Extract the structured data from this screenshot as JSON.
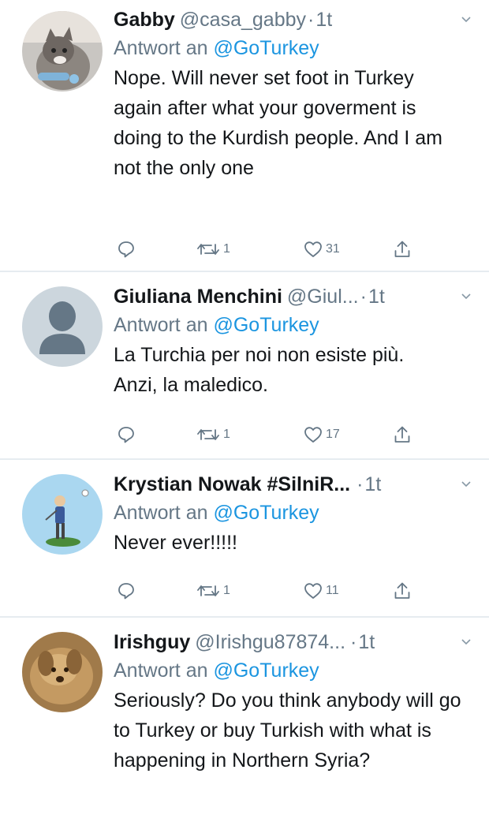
{
  "colors": {
    "accent": "#1b95e0",
    "muted": "#657786",
    "text": "#14171a",
    "divider": "#e6ecf0"
  },
  "tweets": [
    {
      "name": "Gabby",
      "handle": "@casa_gabby",
      "sep": "·",
      "time": "1t",
      "reply_prefix": "Antwort an",
      "reply_to": "@GoTurkey",
      "text": "Nope. Will never set foot in Turkey again after what your goverment is doing to the Kurdish people. And I am not the only one",
      "replies": "",
      "retweets": "1",
      "likes": "31",
      "avatar_icon": "cat-photo-avatar"
    },
    {
      "name": "Giuliana Menchini",
      "handle": "@Giul...",
      "sep": "·",
      "time": "1t",
      "reply_prefix": "Antwort an",
      "reply_to": "@GoTurkey",
      "text": "La Turchia per noi non esiste più. Anzi, la maledico.",
      "replies": "",
      "retweets": "1",
      "likes": "17",
      "avatar_icon": "default-person-avatar"
    },
    {
      "name": "Krystian Nowak #SilniR...",
      "handle": "",
      "sep": "·",
      "time": "1t",
      "reply_prefix": "Antwort an",
      "reply_to": "@GoTurkey",
      "text": "Never ever!!!!!",
      "replies": "",
      "retweets": "1",
      "likes": "11",
      "avatar_icon": "golfer-illustration-avatar"
    },
    {
      "name": "Irishguy",
      "handle": "@Irishgu87874...",
      "sep": "·",
      "time": "1t",
      "reply_prefix": "Antwort an",
      "reply_to": "@GoTurkey",
      "text": "Seriously? Do you think anybody will go to Turkey or buy Turkish with what is happening in Northern Syria?",
      "avatar_icon": "dog-photo-avatar"
    }
  ]
}
